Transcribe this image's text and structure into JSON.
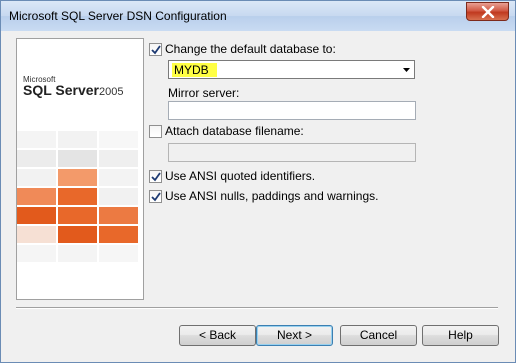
{
  "window": {
    "title": "Microsoft SQL Server DSN Configuration"
  },
  "banner": {
    "logo_brand": "Microsoft",
    "logo_product": "SQL Server",
    "logo_version": "2005"
  },
  "options": {
    "change_default_db": {
      "label": "Change the default database to:",
      "checked": true
    },
    "default_database": {
      "value": "MYDB"
    },
    "mirror_server": {
      "label": "Mirror server:",
      "value": ""
    },
    "attach_db": {
      "label": "Attach database filename:",
      "checked": false,
      "value": ""
    },
    "ansi_quoted": {
      "label": "Use ANSI quoted identifiers.",
      "checked": true
    },
    "ansi_nulls": {
      "label": "Use ANSI nulls, paddings and warnings.",
      "checked": true
    }
  },
  "buttons": {
    "back": "< Back",
    "next": "Next >",
    "cancel": "Cancel",
    "help": "Help"
  },
  "colors": {
    "accent_orange": "#e8682a",
    "highlight": "#ffff44"
  }
}
